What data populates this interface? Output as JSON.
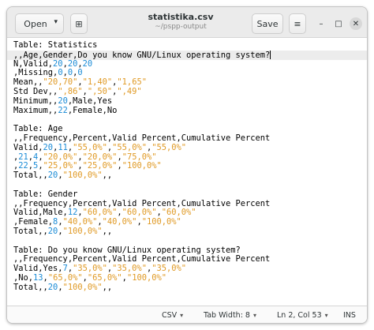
{
  "window": {
    "title": "statistika.csv",
    "subtitle": "~/pspp-output"
  },
  "headerbar": {
    "open_label": "Open",
    "open_chevron": "▾",
    "newtab_icon": "⊞",
    "save_label": "Save",
    "menu_icon": "≡",
    "minimize_icon": "–",
    "maximize_icon": "□",
    "close_icon": "✕"
  },
  "editor": {
    "lines": [
      [
        {
          "t": "Table: Statistics"
        }
      ],
      [
        {
          "t": ",,Age,Gender,Do you know GNU/Linux operating system?"
        }
      ],
      [
        {
          "t": "N,Valid,"
        },
        {
          "t": "20",
          "c": "num"
        },
        {
          "t": ","
        },
        {
          "t": "20",
          "c": "num"
        },
        {
          "t": ","
        },
        {
          "t": "20",
          "c": "num"
        }
      ],
      [
        {
          "t": ",Missing,"
        },
        {
          "t": "0",
          "c": "num"
        },
        {
          "t": ","
        },
        {
          "t": "0",
          "c": "num"
        },
        {
          "t": ","
        },
        {
          "t": "0",
          "c": "num"
        }
      ],
      [
        {
          "t": "Mean,,"
        },
        {
          "t": "\"20,70\"",
          "c": "str"
        },
        {
          "t": ","
        },
        {
          "t": "\"1,40\"",
          "c": "str"
        },
        {
          "t": ","
        },
        {
          "t": "\"1,65\"",
          "c": "str"
        }
      ],
      [
        {
          "t": "Std Dev,,"
        },
        {
          "t": "\",86\"",
          "c": "str"
        },
        {
          "t": ","
        },
        {
          "t": "\",50\"",
          "c": "str"
        },
        {
          "t": ","
        },
        {
          "t": "\",49\"",
          "c": "str"
        }
      ],
      [
        {
          "t": "Minimum,,"
        },
        {
          "t": "20",
          "c": "num"
        },
        {
          "t": ",Male,Yes"
        }
      ],
      [
        {
          "t": "Maximum,,"
        },
        {
          "t": "22",
          "c": "num"
        },
        {
          "t": ",Female,No"
        }
      ],
      [
        {
          "t": ""
        }
      ],
      [
        {
          "t": "Table: Age"
        }
      ],
      [
        {
          "t": ",,Frequency,Percent,Valid Percent,Cumulative Percent"
        }
      ],
      [
        {
          "t": "Valid,"
        },
        {
          "t": "20",
          "c": "num"
        },
        {
          "t": ","
        },
        {
          "t": "11",
          "c": "num"
        },
        {
          "t": ","
        },
        {
          "t": "\"55,0%\"",
          "c": "str"
        },
        {
          "t": ","
        },
        {
          "t": "\"55,0%\"",
          "c": "str"
        },
        {
          "t": ","
        },
        {
          "t": "\"55,0%\"",
          "c": "str"
        }
      ],
      [
        {
          "t": ","
        },
        {
          "t": "21",
          "c": "num"
        },
        {
          "t": ","
        },
        {
          "t": "4",
          "c": "num"
        },
        {
          "t": ","
        },
        {
          "t": "\"20,0%\"",
          "c": "str"
        },
        {
          "t": ","
        },
        {
          "t": "\"20,0%\"",
          "c": "str"
        },
        {
          "t": ","
        },
        {
          "t": "\"75,0%\"",
          "c": "str"
        }
      ],
      [
        {
          "t": ","
        },
        {
          "t": "22",
          "c": "num"
        },
        {
          "t": ","
        },
        {
          "t": "5",
          "c": "num"
        },
        {
          "t": ","
        },
        {
          "t": "\"25,0%\"",
          "c": "str"
        },
        {
          "t": ","
        },
        {
          "t": "\"25,0%\"",
          "c": "str"
        },
        {
          "t": ","
        },
        {
          "t": "\"100,0%\"",
          "c": "str"
        }
      ],
      [
        {
          "t": "Total,,"
        },
        {
          "t": "20",
          "c": "num"
        },
        {
          "t": ","
        },
        {
          "t": "\"100,0%\"",
          "c": "str"
        },
        {
          "t": ",,"
        }
      ],
      [
        {
          "t": ""
        }
      ],
      [
        {
          "t": "Table: Gender"
        }
      ],
      [
        {
          "t": ",,Frequency,Percent,Valid Percent,Cumulative Percent"
        }
      ],
      [
        {
          "t": "Valid,Male,"
        },
        {
          "t": "12",
          "c": "num"
        },
        {
          "t": ","
        },
        {
          "t": "\"60,0%\"",
          "c": "str"
        },
        {
          "t": ","
        },
        {
          "t": "\"60,0%\"",
          "c": "str"
        },
        {
          "t": ","
        },
        {
          "t": "\"60,0%\"",
          "c": "str"
        }
      ],
      [
        {
          "t": ",Female,"
        },
        {
          "t": "8",
          "c": "num"
        },
        {
          "t": ","
        },
        {
          "t": "\"40,0%\"",
          "c": "str"
        },
        {
          "t": ","
        },
        {
          "t": "\"40,0%\"",
          "c": "str"
        },
        {
          "t": ","
        },
        {
          "t": "\"100,0%\"",
          "c": "str"
        }
      ],
      [
        {
          "t": "Total,,"
        },
        {
          "t": "20",
          "c": "num"
        },
        {
          "t": ","
        },
        {
          "t": "\"100,0%\"",
          "c": "str"
        },
        {
          "t": ",,"
        }
      ],
      [
        {
          "t": ""
        }
      ],
      [
        {
          "t": "Table: Do you know GNU/Linux operating system?"
        }
      ],
      [
        {
          "t": ",,Frequency,Percent,Valid Percent,Cumulative Percent"
        }
      ],
      [
        {
          "t": "Valid,Yes,"
        },
        {
          "t": "7",
          "c": "num"
        },
        {
          "t": ","
        },
        {
          "t": "\"35,0%\"",
          "c": "str"
        },
        {
          "t": ","
        },
        {
          "t": "\"35,0%\"",
          "c": "str"
        },
        {
          "t": ","
        },
        {
          "t": "\"35,0%\"",
          "c": "str"
        }
      ],
      [
        {
          "t": ",No,"
        },
        {
          "t": "13",
          "c": "num"
        },
        {
          "t": ","
        },
        {
          "t": "\"65,0%\"",
          "c": "str"
        },
        {
          "t": ","
        },
        {
          "t": "\"65,0%\"",
          "c": "str"
        },
        {
          "t": ","
        },
        {
          "t": "\"100,0%\"",
          "c": "str"
        }
      ],
      [
        {
          "t": "Total,,"
        },
        {
          "t": "20",
          "c": "num"
        },
        {
          "t": ","
        },
        {
          "t": "\"100,0%\"",
          "c": "str"
        },
        {
          "t": ",,"
        }
      ]
    ],
    "current_line": 2,
    "colors": {
      "number": "#1a8bd6",
      "string": "#e09a25"
    }
  },
  "statusbar": {
    "language": "CSV",
    "tab_width": "Tab Width: 8",
    "position": "Ln 2, Col 53",
    "mode": "INS",
    "dropdown_caret": "▾"
  }
}
